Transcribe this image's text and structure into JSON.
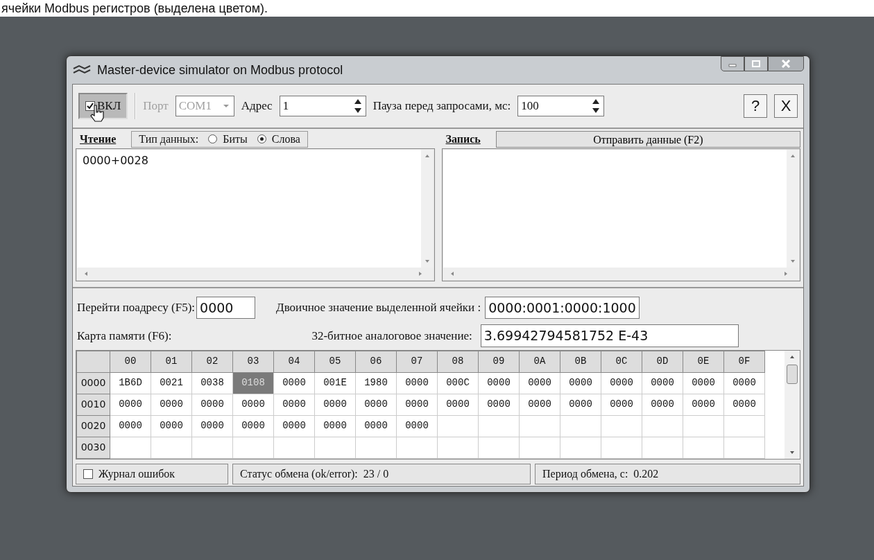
{
  "page_caption": "ячейки Modbus регистров (выделена цветом).",
  "window": {
    "title": "Master-device simulator on Modbus protocol"
  },
  "toolbar": {
    "power": {
      "label": "ВКЛ",
      "checked": true
    },
    "port": {
      "label": "Порт",
      "value": "COM1",
      "disabled": true
    },
    "address": {
      "label": "Адрес",
      "value": "1"
    },
    "pause": {
      "label": "Пауза перед запросами, мс:",
      "value": "100"
    },
    "help": "?",
    "close": "X"
  },
  "read_panel": {
    "title": "Чтение",
    "data_type_label": "Тип данных:",
    "options": [
      {
        "label": "Биты",
        "selected": false
      },
      {
        "label": "Слова",
        "selected": true
      }
    ],
    "text": "0000+0028"
  },
  "write_panel": {
    "title": "Запись",
    "send_button": "Отправить данные (F2)"
  },
  "goto": {
    "label": "Перейти поадресу (F5):",
    "value": "0000"
  },
  "binary": {
    "label": "Двоичное значение выделенной ячейки :",
    "value": "0000:0001:0000:1000"
  },
  "memory_map_label": "Карта памяти (F6):",
  "analog": {
    "label": "32-битное аналоговое значение:",
    "value": "3.69942794581752 E-43"
  },
  "table": {
    "columns": [
      "00",
      "01",
      "02",
      "03",
      "04",
      "05",
      "06",
      "07",
      "08",
      "09",
      "0A",
      "0B",
      "0C",
      "0D",
      "0E",
      "0F"
    ],
    "rows": [
      {
        "address": "0000",
        "cells": [
          {
            "value": "1B6D",
            "selected": false
          },
          {
            "value": "0021",
            "selected": false
          },
          {
            "value": "0038",
            "selected": false
          },
          {
            "value": "0108",
            "selected": true
          },
          {
            "value": "0000",
            "selected": false
          },
          {
            "value": "001E",
            "selected": false
          },
          {
            "value": "1980",
            "selected": false
          },
          {
            "value": "0000",
            "selected": false
          },
          {
            "value": "000C",
            "selected": false
          },
          {
            "value": "0000",
            "selected": false
          },
          {
            "value": "0000",
            "selected": false
          },
          {
            "value": "0000",
            "selected": false
          },
          {
            "value": "0000",
            "selected": false
          },
          {
            "value": "0000",
            "selected": false
          },
          {
            "value": "0000",
            "selected": false
          },
          {
            "value": "0000",
            "selected": false
          }
        ]
      },
      {
        "address": "0010",
        "cells": [
          {
            "value": "0000",
            "selected": false
          },
          {
            "value": "0000",
            "selected": false
          },
          {
            "value": "0000",
            "selected": false
          },
          {
            "value": "0000",
            "selected": false
          },
          {
            "value": "0000",
            "selected": false
          },
          {
            "value": "0000",
            "selected": false
          },
          {
            "value": "0000",
            "selected": false
          },
          {
            "value": "0000",
            "selected": false
          },
          {
            "value": "0000",
            "selected": false
          },
          {
            "value": "0000",
            "selected": false
          },
          {
            "value": "0000",
            "selected": false
          },
          {
            "value": "0000",
            "selected": false
          },
          {
            "value": "0000",
            "selected": false
          },
          {
            "value": "0000",
            "selected": false
          },
          {
            "value": "0000",
            "selected": false
          },
          {
            "value": "0000",
            "selected": false
          }
        ]
      },
      {
        "address": "0020",
        "cells": [
          {
            "value": "0000",
            "selected": false
          },
          {
            "value": "0000",
            "selected": false
          },
          {
            "value": "0000",
            "selected": false
          },
          {
            "value": "0000",
            "selected": false
          },
          {
            "value": "0000",
            "selected": false
          },
          {
            "value": "0000",
            "selected": false
          },
          {
            "value": "0000",
            "selected": false
          },
          {
            "value": "0000",
            "selected": false
          }
        ]
      },
      {
        "address": "0030"
      }
    ]
  },
  "status_bar": {
    "error_log": {
      "label": "Журнал ошибок",
      "checked": false
    },
    "exchange_status_label": "Статус обмена (ok/error):",
    "exchange_status_value": "23 / 0",
    "exchange_period_label": "Период обмена, с:",
    "exchange_period_value": "0.202"
  }
}
